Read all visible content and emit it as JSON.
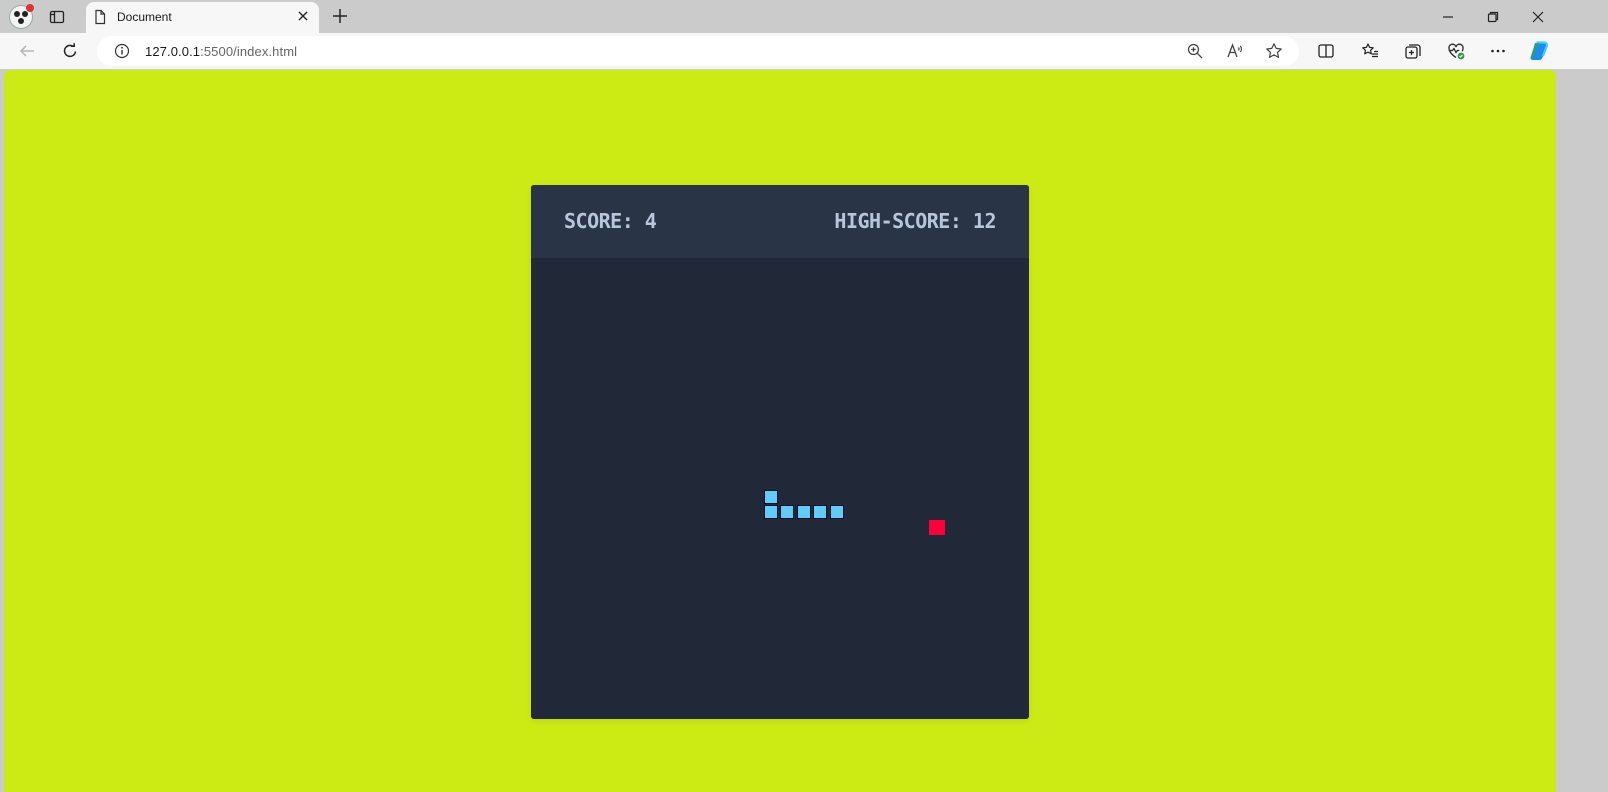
{
  "browser": {
    "tab_title": "Document",
    "url_host": "127.0.0.1",
    "url_path": ":5500/index.html"
  },
  "game": {
    "score_text": "Score: 4",
    "high_score_text": "High-Score: 12"
  },
  "colors": {
    "page_background": "#ccea13",
    "board_background": "#212837",
    "header_background": "#293447",
    "snake": "#60cbff",
    "food": "#ff003d",
    "score_text": "#b8c6dc"
  },
  "icons": {
    "profile": "profile-avatar-icon",
    "workspaces": "tab-actions-icon",
    "document": "document-icon",
    "close": "close-icon",
    "new_tab": "plus-icon",
    "back": "back-arrow-icon",
    "refresh": "refresh-icon",
    "info": "info-icon",
    "zoom": "zoom-icon",
    "read_aloud": "read-aloud-icon",
    "favorite": "star-icon",
    "split_screen": "split-screen-icon",
    "favorites": "favorites-list-icon",
    "collections": "collections-icon",
    "browser_essentials": "heart-pulse-icon",
    "more": "more-icon",
    "copilot": "copilot-icon"
  }
}
